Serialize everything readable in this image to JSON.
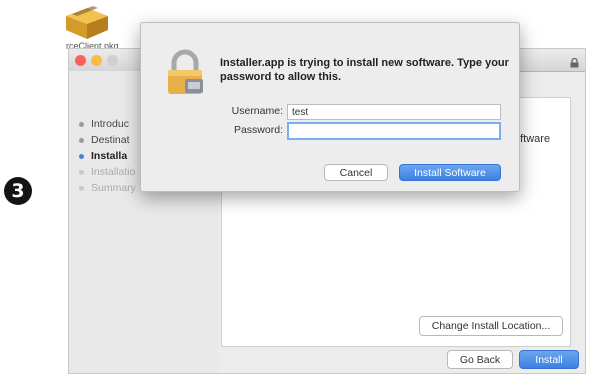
{
  "step": {
    "number": "3"
  },
  "desktop": {
    "package_label": "rceClient.pkg"
  },
  "installer": {
    "sidebar": {
      "items": [
        {
          "label": "Introduc",
          "active": false
        },
        {
          "label": "Destinat",
          "active": false
        },
        {
          "label": "Installa",
          "active": true
        },
        {
          "label": "Installatio",
          "active": false
        },
        {
          "label": "Summary",
          "active": false
        }
      ]
    },
    "content_partial_text": "oftware",
    "change_location_label": "Change Install Location...",
    "go_back_label": "Go Back",
    "install_label": "Install"
  },
  "auth_dialog": {
    "message": "Installer.app is trying to install new software. Type your password to allow this.",
    "username_label": "Username:",
    "username_value": "test",
    "password_label": "Password:",
    "password_value": "",
    "cancel_label": "Cancel",
    "install_software_label": "Install Software"
  },
  "colors": {
    "accent_blue": "#3d80e0",
    "traffic_red": "#fc605b",
    "traffic_yellow": "#fdbc40"
  },
  "icons": [
    "package-icon",
    "lock-icon",
    "padlock-icon"
  ]
}
